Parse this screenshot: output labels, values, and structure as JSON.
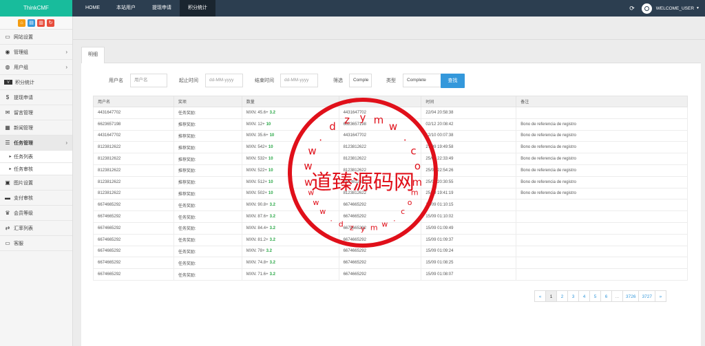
{
  "brand": "ThinkCMF",
  "topnav": [
    "HOME",
    "本站用户",
    "提现申请",
    "积分统计"
  ],
  "user": "WELCOME_USER",
  "sidebar": {
    "items": [
      {
        "label": "网站设置"
      },
      {
        "label": "管理组"
      },
      {
        "label": "用户组"
      },
      {
        "label": "积分统计"
      },
      {
        "label": "提现申请"
      },
      {
        "label": "留言管理"
      },
      {
        "label": "新闻管理"
      },
      {
        "label": "任务管理"
      },
      {
        "label": "任务列表"
      },
      {
        "label": "任务审核"
      },
      {
        "label": "图片设置"
      },
      {
        "label": "支付审核"
      },
      {
        "label": "会员等级"
      },
      {
        "label": "汇率列表"
      },
      {
        "label": "客服"
      }
    ]
  },
  "tab": "明细",
  "filters": {
    "username_label": "用户名",
    "username_placeholder": "用户名",
    "start_label": "起止时间",
    "start_placeholder": "dd-MM-yyyy",
    "end_label": "结束时间",
    "end_placeholder": "dd-MM-yyyy",
    "filter_label": "筛选",
    "filter_value": "Comple",
    "type_label": "类型",
    "type_value": "Complete",
    "search_button": "查找"
  },
  "table": {
    "headers": [
      "用户名",
      "奖项",
      "数量",
      "对象",
      "时间",
      "备注"
    ],
    "rows": [
      [
        "4431647702",
        "任务奖励:",
        "MXN: 45.6+",
        "3.2",
        "4431647702",
        "22/04 20:58:38",
        ""
      ],
      [
        "6623657198",
        "推荐奖励:",
        "MXN: 12+",
        "10",
        "6623657198",
        "02/12 20:08:42",
        "Bono de referencia de registro"
      ],
      [
        "4431647702",
        "推荐奖励:",
        "MXN: 35.6+",
        "10",
        "4431647702",
        "12/10 00:07:38",
        "Bono de referencia de registro"
      ],
      [
        "8123812622",
        "推荐奖励:",
        "MXN: 542+",
        "10",
        "8123812622",
        "27/09 19:49:58",
        "Bono de referencia de registro"
      ],
      [
        "8123812622",
        "推荐奖励:",
        "MXN: 532+",
        "10",
        "8123812622",
        "25/09 22:33:49",
        "Bono de referencia de registro"
      ],
      [
        "8123812622",
        "推荐奖励:",
        "MXN: 522+",
        "10",
        "8123812622",
        "25/09 22:54:26",
        "Bono de referencia de registro"
      ],
      [
        "8123812622",
        "推荐奖励:",
        "MXN: 512+",
        "10",
        "8123812622",
        "25/09 20:30:55",
        "Bono de referencia de registro"
      ],
      [
        "8123812622",
        "推荐奖励:",
        "MXN: 502+",
        "10",
        "8123812622",
        "25/09 19:41:19",
        "Bono de referencia de registro"
      ],
      [
        "6674665292",
        "任务奖励:",
        "MXN: 90.8+",
        "3.2",
        "6674665292",
        "15/09 01:10:15",
        ""
      ],
      [
        "6674665292",
        "任务奖励:",
        "MXN: 87.6+",
        "3.2",
        "6674665292",
        "15/09 01:10:02",
        ""
      ],
      [
        "6674665292",
        "任务奖励:",
        "MXN: 84.4+",
        "3.2",
        "6674665292",
        "15/09 01:09:49",
        ""
      ],
      [
        "6674665292",
        "任务奖励:",
        "MXN: 81.2+",
        "3.2",
        "6674665292",
        "15/09 01:09:37",
        ""
      ],
      [
        "6674665292",
        "任务奖励:",
        "MXN: 78+",
        "3.2",
        "6674665292",
        "15/09 01:09:24",
        ""
      ],
      [
        "6674665292",
        "任务奖励:",
        "MXN: 74.8+",
        "3.2",
        "6674665292",
        "15/09 01:08:25",
        ""
      ],
      [
        "6674665292",
        "任务奖励:",
        "MXN: 71.6+",
        "3.2",
        "6674665292",
        "15/09 01:08:07",
        ""
      ]
    ]
  },
  "pagination": [
    "«",
    "1",
    "2",
    "3",
    "4",
    "5",
    "6",
    "...",
    "3726",
    "3727",
    "»"
  ],
  "watermark": {
    "text": "道臻源码网",
    "top_letters": [
      "w",
      "w",
      "w",
      ".",
      "d",
      "z",
      "y",
      "m",
      "w",
      ".",
      "c",
      "o",
      "m"
    ],
    "bottom_letters": [
      "w",
      "w",
      "w",
      ".",
      "d",
      "z",
      "y",
      "m",
      "w",
      ".",
      "c",
      "o",
      "m"
    ],
    "color": "#e0101a"
  }
}
